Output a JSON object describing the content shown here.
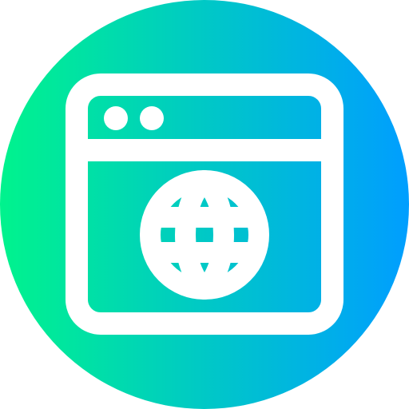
{
  "icon": {
    "name": "web-browser-globe-icon",
    "gradient": {
      "start": "#00f38d",
      "end": "#009eff"
    },
    "foreground": "#ffffff"
  }
}
